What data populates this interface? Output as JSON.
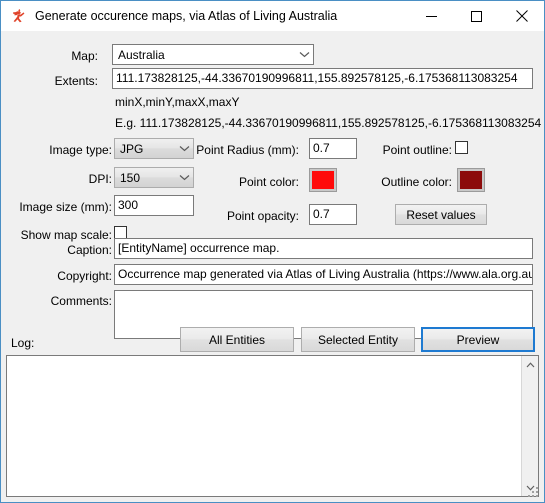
{
  "window": {
    "title": "Generate occurence maps, via Atlas of Living Australia",
    "icon": "kangaroo-icon",
    "minimize_label": "minimize-icon",
    "maximize_label": "maximize-icon",
    "close_label": "close-icon"
  },
  "form": {
    "map": {
      "label": "Map:",
      "value": "Australia"
    },
    "extents": {
      "label": "Extents:",
      "value": "111.173828125,-44.33670190996811,155.892578125,-6.175368113083254",
      "hint": "minX,minY,maxX,maxY",
      "example": "E.g. 111.173828125,-44.33670190996811,155.892578125,-6.175368113083254"
    },
    "image_type": {
      "label": "Image type:",
      "value": "JPG"
    },
    "dpi": {
      "label": "DPI:",
      "value": "150"
    },
    "image_size": {
      "label": "Image size (mm):",
      "value": "300"
    },
    "show_map_scale": {
      "label": "Show map scale:",
      "checked": false
    },
    "point_radius": {
      "label": "Point Radius (mm):",
      "value": "0.7"
    },
    "point_color": {
      "label": "Point color:",
      "color": "#FF0A0A"
    },
    "point_opacity": {
      "label": "Point opacity:",
      "value": "0.7"
    },
    "point_outline": {
      "label": "Point outline:",
      "checked": false
    },
    "outline_color": {
      "label": "Outline color:",
      "color": "#8C0B0B"
    },
    "reset_values": {
      "label": "Reset values"
    },
    "caption": {
      "label": "Caption:",
      "value": "[EntityName] occurrence map."
    },
    "copyright": {
      "label": "Copyright:",
      "value": "Occurrence map generated via Atlas of Living Australia (https://www.ala.org.au)."
    },
    "comments": {
      "label": "Comments:",
      "value": ""
    }
  },
  "actions": {
    "all_entities": "All Entities",
    "selected_entity": "Selected Entity",
    "preview": "Preview"
  },
  "log": {
    "label": "Log:",
    "content": "",
    "scroll_up_icon": "chevron-up-icon",
    "scroll_down_icon": "chevron-down-icon"
  }
}
